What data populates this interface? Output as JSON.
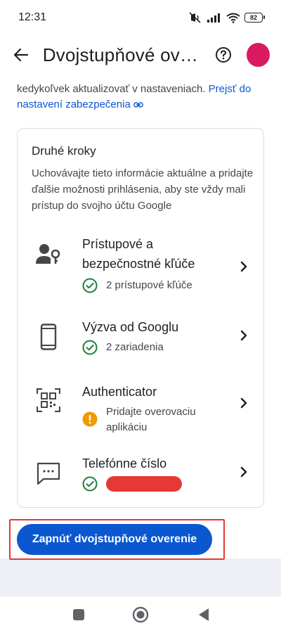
{
  "status_bar": {
    "time": "12:31",
    "battery": "82"
  },
  "app_bar": {
    "title": "Dvojstupňové ov…"
  },
  "intro": {
    "partial_line": "",
    "text": "kedykoľvek aktualizovať v nastaveniach.",
    "link": "Prejsť do nastavení zabezpečenia"
  },
  "second_steps": {
    "title": "Druhé kroky",
    "description": "Uchovávajte tieto informácie aktuálne a pridajte ďalšie možnosti prihlásenia, aby ste vždy mali prístup do svojho účtu Google",
    "items": [
      {
        "title": "Prístupové a bezpečnostné kľúče",
        "status": "2 prístupové kľúče",
        "status_type": "ok",
        "icon": "passkey-icon"
      },
      {
        "title": "Výzva od Googlu",
        "status": "2 zariadenia",
        "status_type": "ok",
        "icon": "phone-icon"
      },
      {
        "title": "Authenticator",
        "status": "Pridajte overovaciu aplikáciu",
        "status_type": "warning",
        "icon": "qr-code-icon"
      },
      {
        "title": "Telefónne číslo",
        "status": "",
        "status_type": "ok-redacted",
        "icon": "sms-icon"
      }
    ]
  },
  "cta": {
    "label": "Zapnúť dvojstupňové overenie"
  },
  "colors": {
    "accent": "#0b57d0",
    "avatar": "#d81b60",
    "success": "#188038",
    "warning": "#f29900",
    "highlight": "#e53935"
  }
}
